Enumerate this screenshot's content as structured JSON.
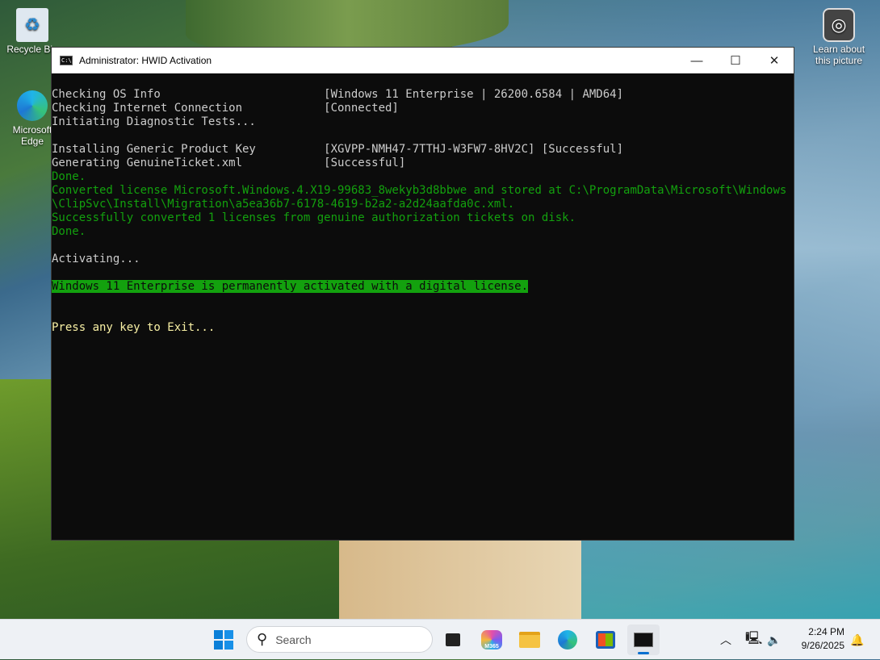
{
  "desktop": {
    "icons": [
      {
        "label": "Recycle Bin"
      },
      {
        "label": "Microsoft Edge"
      }
    ],
    "spotlight_label": "Learn about this picture"
  },
  "window": {
    "title": "Administrator:  HWID Activation",
    "app_icon_text": "C:\\"
  },
  "console": {
    "lines": [
      {
        "text": "Checking OS Info                        [Windows 11 Enterprise | 26200.6584 | AMD64]",
        "style": ""
      },
      {
        "text": "Checking Internet Connection            [Connected]",
        "style": ""
      },
      {
        "text": "Initiating Diagnostic Tests...",
        "style": ""
      },
      {
        "text": "",
        "style": ""
      },
      {
        "text": "Installing Generic Product Key          [XGVPP-NMH47-7TTHJ-W3FW7-8HV2C] [Successful]",
        "style": ""
      },
      {
        "text": "Generating GenuineTicket.xml            [Successful]",
        "style": ""
      },
      {
        "text": "Done.",
        "style": "g"
      },
      {
        "text": "Converted license Microsoft.Windows.4.X19-99683_8wekyb3d8bbwe and stored at C:\\ProgramData\\Microsoft\\Windows",
        "style": "g"
      },
      {
        "text": "\\ClipSvc\\Install\\Migration\\a5ea36b7-6178-4619-b2a2-a2d24aafda0c.xml.",
        "style": "g"
      },
      {
        "text": "Successfully converted 1 licenses from genuine authorization tickets on disk.",
        "style": "g"
      },
      {
        "text": "Done.",
        "style": "g"
      },
      {
        "text": "",
        "style": ""
      },
      {
        "text": "Activating...",
        "style": ""
      },
      {
        "text": "",
        "style": ""
      },
      {
        "text": "Windows 11 Enterprise is permanently activated with a digital license.",
        "style": "hl"
      },
      {
        "text": "",
        "style": ""
      },
      {
        "text": "",
        "style": ""
      },
      {
        "text": "Press any key to Exit...",
        "style": "y"
      }
    ]
  },
  "taskbar": {
    "search_placeholder": "Search",
    "m365_badge": "M365",
    "time": "2:24 PM",
    "date": "9/26/2025"
  },
  "colors": {
    "green": "#13a10e",
    "console_bg": "#0c0c0c",
    "prompt_yellow": "#f9f1a5"
  }
}
